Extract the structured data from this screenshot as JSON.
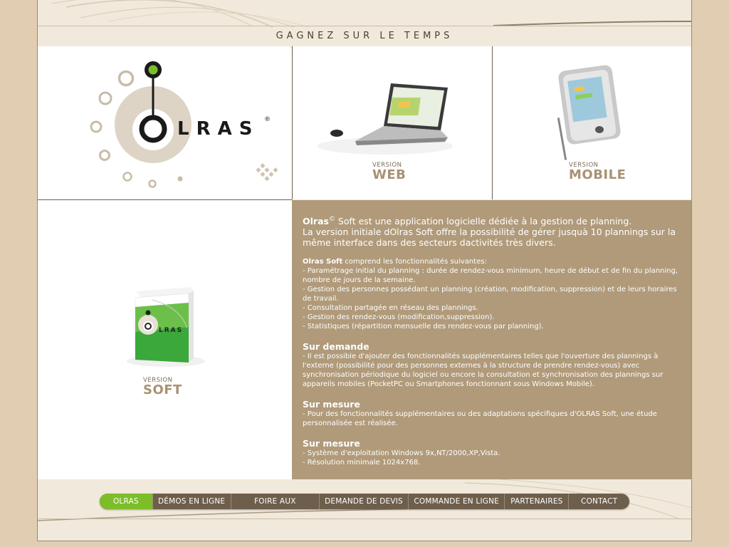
{
  "site": {
    "tagline": "GAGNEZ SUR LE TEMPS",
    "logo_text": "LRAS",
    "logo_mark": "®"
  },
  "products": [
    {
      "version_label": "VERSION",
      "name": "WEB"
    },
    {
      "version_label": "VERSION",
      "name": "MOBILE"
    },
    {
      "version_label": "VERSION",
      "name": "SOFT"
    }
  ],
  "box_logo_text": "LRAS",
  "content": {
    "intro_brand": "Olras",
    "intro_copyright": "©",
    "intro_line1": " Soft est une application logicielle dédiée à la gestion de planning.",
    "intro_line2": "La version initiale dOlras Soft offre la possibilité de gérer jusquà 10 plannings sur la même interface dans des secteurs dactivités très divers.",
    "features_brand": "Olras Soft",
    "features_intro": " comprend les fonctionnalités suivantes:",
    "features": [
      "  - Paramétrage initial du planning : durée de rendez-vous minimum, heure de début et de fin du planning, nombre de jours de la semaine.",
      "  - Gestion des personnes possédant un planning (création, modification, suppression) et de leurs horaires de travail.",
      "  - Consultation partagée en réseau des plannings.",
      "  - Gestion des rendez-vous (modification,suppression).",
      "  - Statistiques (répartition mensuelle des rendez-vous par planning)."
    ],
    "sections": [
      {
        "title": "Sur demande",
        "text": "  - Il est possible d'ajouter des fonctionnalités supplémentaires telles que l'ouverture des plannings à l'externe (possibilité pour des personnes externes à la structure de prendre rendez-vous) avec synchronisation périodique du logiciel ou encore la consultation et synchronisation des plannings sur appareils mobiles (PocketPC ou Smartphones fonctionnant sous Windows Mobile)."
      },
      {
        "title": "Sur mesure",
        "text": "  - Pour des fonctionnalités supplémentaires ou des adaptations spécifiques d'OLRAS Soft, une étude personnalisée est réalisée."
      }
    ],
    "requirements_title": "Sur mesure",
    "requirements": [
      "  - Système d'exploitation Windows 9x,NT/2000,XP,Vista.",
      "  - Résolution minimale 1024x768."
    ]
  },
  "nav": {
    "items": [
      "OLRAS",
      "DÉMOS EN LIGNE",
      "FOIRE AUX QUESTIONS",
      "DEMANDE DE DEVIS",
      "COMMANDE EN LIGNE",
      "PARTENAIRES",
      "CONTACT"
    ],
    "active_color": "#7dbd2a",
    "bar_color": "#6e5e4c"
  },
  "colors": {
    "page_bg": "#e0cdb2",
    "frame_bg": "#f1e9db",
    "text_panel_bg": "#b09a7a",
    "accent_green": "#7dbd2a"
  }
}
